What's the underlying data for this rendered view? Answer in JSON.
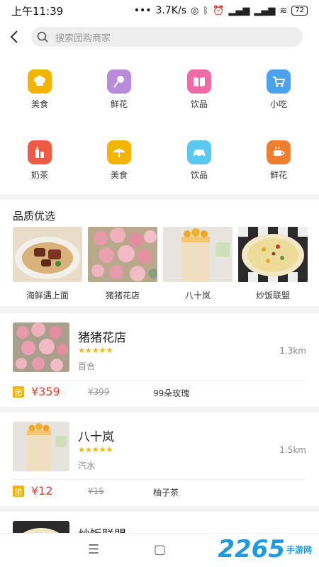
{
  "status_bar": {
    "time": "上午11:39",
    "dots": "•••",
    "speed": "3.7K/s",
    "battery": "72"
  },
  "search": {
    "placeholder": "搜索团购商家"
  },
  "categories": [
    {
      "label": "美食",
      "icon": "chef-hat-icon",
      "color": "#f5b400"
    },
    {
      "label": "鲜花",
      "icon": "flower-icon",
      "color": "#b98bdc"
    },
    {
      "label": "饮品",
      "icon": "book-icon",
      "color": "#f06aa8"
    },
    {
      "label": "小吃",
      "icon": "cart-icon",
      "color": "#4aa3f0"
    },
    {
      "label": "奶茶",
      "icon": "bottle-icon",
      "color": "#f05a45"
    },
    {
      "label": "美食",
      "icon": "umbrella-icon",
      "color": "#f5b400"
    },
    {
      "label": "饮品",
      "icon": "car-icon",
      "color": "#5ac8f0"
    },
    {
      "label": "鲜花",
      "icon": "coffee-icon",
      "color": "#f08030"
    }
  ],
  "quality": {
    "title": "品质优选",
    "items": [
      {
        "name": "海鲜遇上面"
      },
      {
        "name": "猪猪花店"
      },
      {
        "name": "八十岚"
      },
      {
        "name": "炒饭联盟"
      }
    ]
  },
  "shops": [
    {
      "name": "猪猪花店",
      "stars": "★★★★★",
      "rating": 5,
      "tag": "百合",
      "distance": "1.3km",
      "tuan": "团",
      "price": "¥359",
      "old_price": "¥399",
      "deal": "99朵玫瑰"
    },
    {
      "name": "八十岚",
      "stars": "★★★★★",
      "rating": 5,
      "tag": "汽水",
      "distance": "1.5km",
      "tuan": "团",
      "price": "¥12",
      "old_price": "¥15",
      "deal": "柚子茶"
    },
    {
      "name": "炒饭联盟"
    }
  ],
  "watermark": {
    "brand": "2265",
    "site": "手游网"
  }
}
